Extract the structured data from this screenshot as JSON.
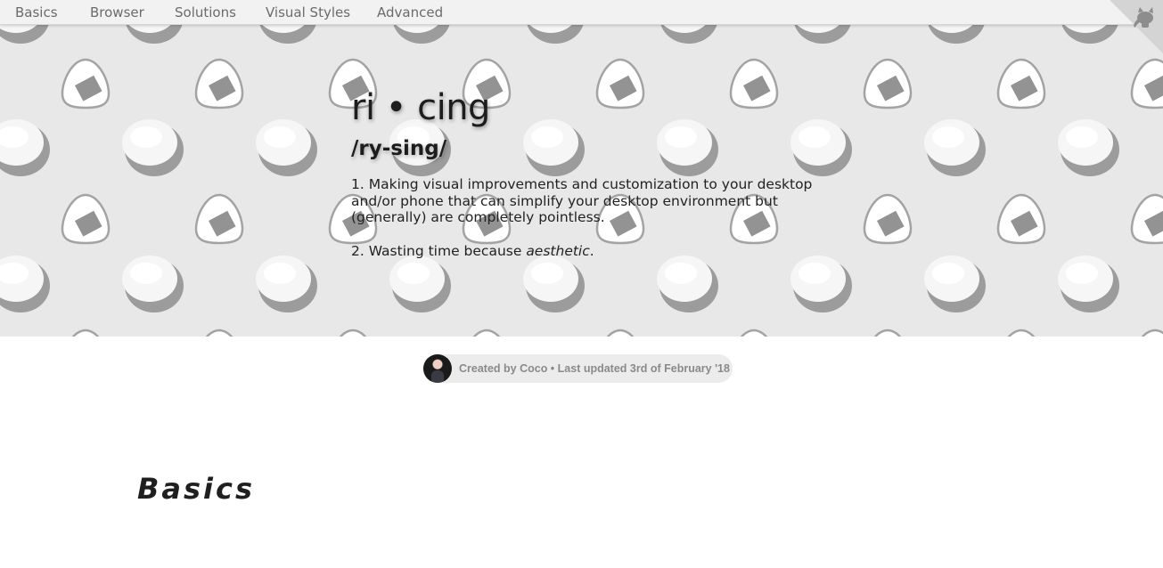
{
  "nav": {
    "items": [
      {
        "label": "Basics"
      },
      {
        "label": "Browser"
      },
      {
        "label": "Solutions"
      },
      {
        "label": "Visual Styles"
      },
      {
        "label": "Advanced"
      }
    ],
    "corner_icon": "github-cat-icon"
  },
  "hero": {
    "title": "ri • cing",
    "pronunciation": "/ry-sing/",
    "definition_1": "1. Making visual improvements and customization to your desktop and/or phone that can simplify your desktop environment but (generally) are completely pointless.",
    "definition_2_prefix": "2. Wasting time because ",
    "definition_2_emphasis": "aesthetic",
    "definition_2_suffix": ".",
    "pattern_icons": [
      "onigiri-icon",
      "rice-bowl-icon"
    ]
  },
  "credit": {
    "text": "Created by Coco • Last updated 3rd of February '18"
  },
  "section": {
    "heading": "Basics"
  },
  "colors": {
    "nav_bg": "#f2f2f2",
    "hero_bg": "#e8e8e8",
    "pattern_gray": "#9a9a9a",
    "credit_bg": "#ececec"
  }
}
